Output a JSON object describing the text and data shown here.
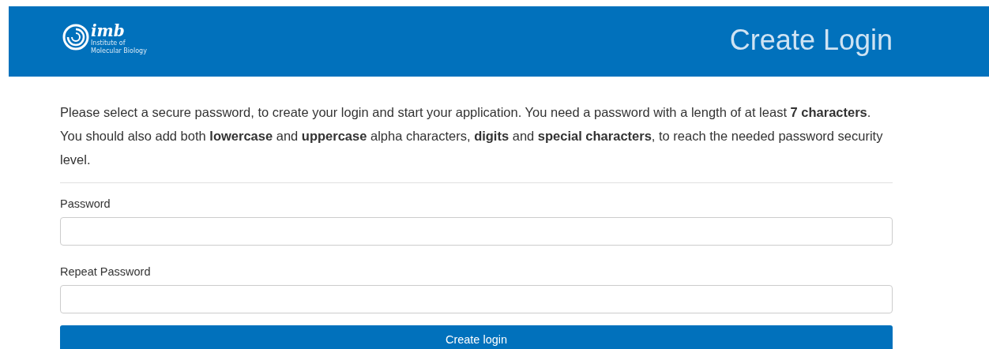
{
  "header": {
    "logo": {
      "wordmark": "imb",
      "subtitle_lines": [
        "Institute of",
        "Molecular Biology"
      ]
    },
    "title": "Create Login"
  },
  "intro": "Please select a secure password, to create your login and start your application. You need a password with a length of at least **7 characters**. You should also add both **lowercase** and **uppercase** alpha characters, **digits** and **special characters**, to reach the needed password security level.",
  "fields": [
    {
      "label": "Password"
    },
    {
      "label": "Repeat Password"
    }
  ],
  "button": "Create login"
}
